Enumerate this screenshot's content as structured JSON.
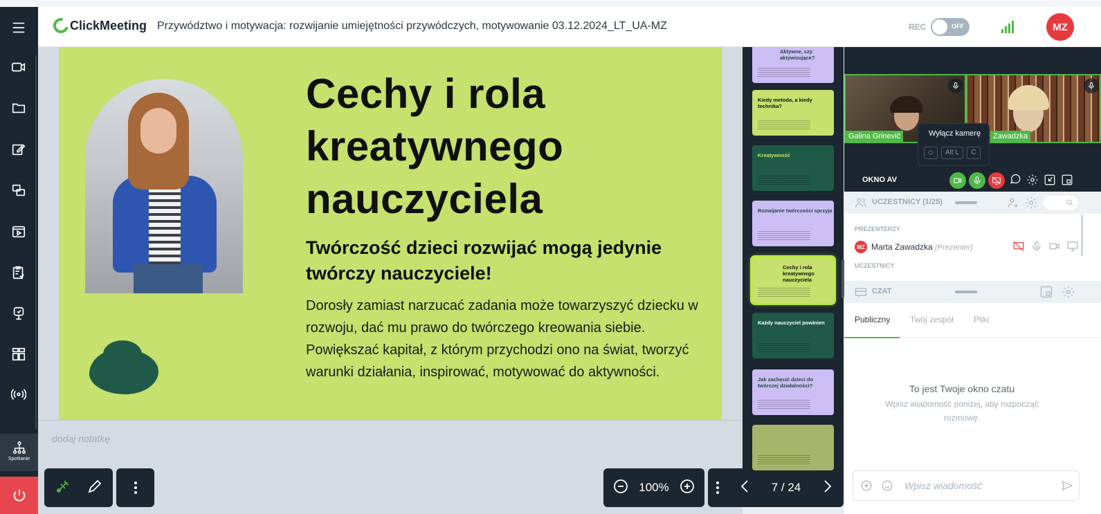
{
  "app": {
    "logo_text": "ClickMeeting",
    "meeting_title": "Przywództwo i motywacja: rozwijanie umiejętności przywódczych, motywowanie 03.12.2024_LT_UA-MZ"
  },
  "header": {
    "rec_label": "REC",
    "rec_state": "OFF",
    "user_initials": "MZ",
    "accent": "#50b848",
    "avatar_color": "#e8393f"
  },
  "sidebar": {
    "items": [
      {
        "icon": "menu-icon"
      },
      {
        "icon": "video-camera-icon"
      },
      {
        "icon": "folder-icon"
      },
      {
        "icon": "edit-icon"
      },
      {
        "icon": "screen-share-icon"
      },
      {
        "icon": "media-player-icon"
      },
      {
        "icon": "survey-icon"
      },
      {
        "icon": "whiteboard-icon"
      },
      {
        "icon": "apps-grid-icon"
      },
      {
        "icon": "broadcast-icon"
      }
    ],
    "active_label": "Spotkanie"
  },
  "slide": {
    "title": "Cechy i rola kreatywnego nauczyciela",
    "subtitle": "Twórczość dzieci rozwijać mogą jedynie twórczy nauczyciele!",
    "body": "Dorosły zamiast narzucać zadania może towarzyszyć dziecku w rozwoju, dać mu prawo do twórczego kreowania siebie. Powiększać kapitał, z którym przychodzi ono na świat, tworzyć warunki działania, inspirować, motywować do aktywności.",
    "background": "#c6e16d"
  },
  "notes": {
    "placeholder": "dodaj notatkę"
  },
  "toolbar": {
    "zoom": "100%",
    "page": "7 / 24"
  },
  "thumbnails": [
    {
      "title": "Aktywne, czy aktywizujące?",
      "bg": "#cdbdf5",
      "fg": "#1d4a3e"
    },
    {
      "title": "Kiedy metoda, a kiedy technika?",
      "bg": "#c6e16d",
      "fg": "#101010"
    },
    {
      "title": "Kreatywność",
      "bg": "#1f5a48",
      "fg": "#c6e16d"
    },
    {
      "title": "Rozwijanie twórczości sprzyja",
      "bg": "#cdbdf5",
      "fg": "#1d4a3e"
    },
    {
      "title": "Cechy i rola kreatywnego nauczyciela",
      "bg": "#c6e16d",
      "fg": "#101010"
    },
    {
      "title": "Każdy nauczyciel powinien",
      "bg": "#1f5a48",
      "fg": "#ffffff"
    },
    {
      "title": "Jak zachęcić dzieci do twórczej działalności?",
      "bg": "#cdbdf5",
      "fg": "#1d4a3e"
    },
    {
      "title": "",
      "bg": "#a7b56a",
      "fg": "#101010"
    }
  ],
  "av": {
    "video1_name": "Galina Grinevič",
    "video2_name": "Zawadzka",
    "tooltip": "Wyłącz kamerę",
    "kbd1": "◇",
    "kbd2": "Alt L",
    "kbd3": "C",
    "label": "OKNO AV"
  },
  "participants": {
    "header": "UCZESTNICY (1/25)",
    "presenters_label": "PREZENTERZY",
    "presenter_initials": "MZ",
    "presenter_name": "Marta Zawadzka",
    "presenter_role": "(Prezenter)",
    "participants_label": "UCZESTNICY"
  },
  "chat": {
    "header": "CZAT",
    "tabs": [
      "Publiczny",
      "Twój zespół",
      "Pliki"
    ],
    "empty_title": "To jest Twoje okno czatu",
    "empty_sub": "Wpisz wiadomość poniżej, aby rozpocząć rozmowę.",
    "input_placeholder": "Wpisz wiadomość"
  }
}
